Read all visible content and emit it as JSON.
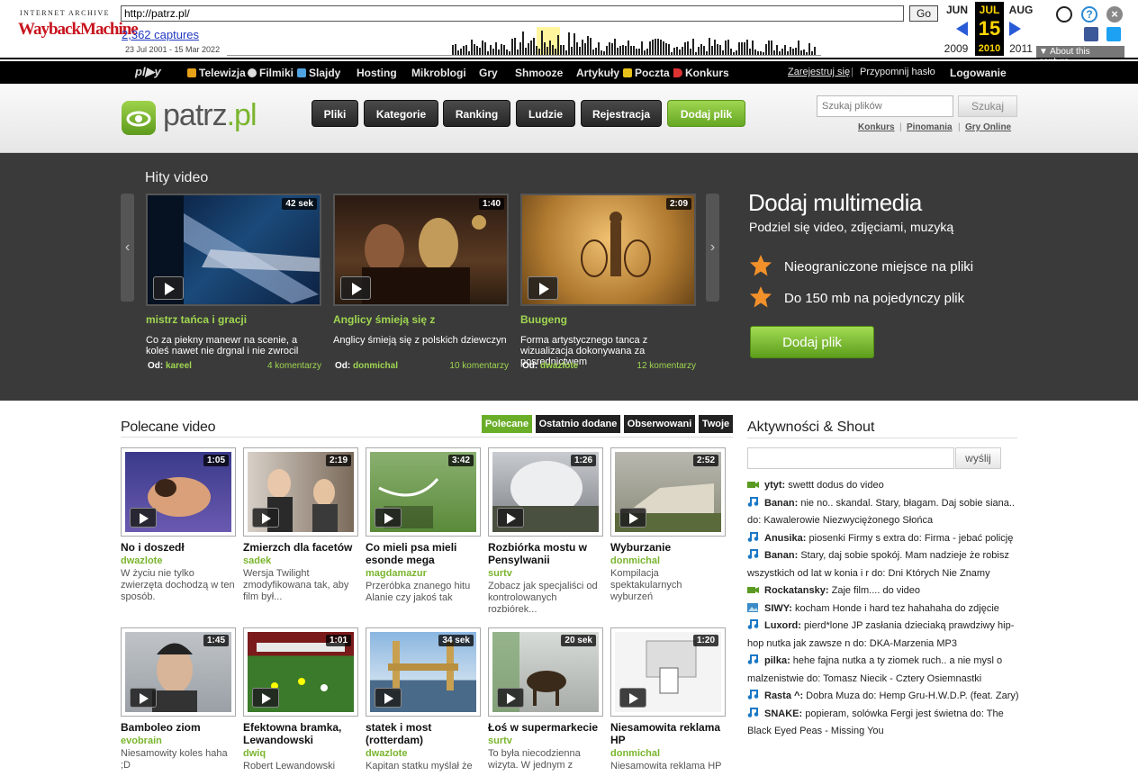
{
  "wayback": {
    "logo_top": "INTERNET ARCHIVE",
    "logo_main": "WaybackMachine",
    "url": "http://patrz.pl/",
    "go": "Go",
    "captures": "2,362 captures",
    "range": "23 Jul 2001 - 15 Mar 2022",
    "prev_month": "JUN",
    "cur_month": "JUL",
    "next_month": "AUG",
    "prev_year": "2009",
    "cur_day": "15",
    "cur_year": "2010",
    "next_year": "2011",
    "about": "▼ About this capture"
  },
  "topnav": {
    "items": [
      "Telewizja",
      "Filmiki",
      "Slajdy",
      "Hosting",
      "Mikroblogi",
      "Gry",
      "Shmooze",
      "Artykuły",
      "Poczta",
      "Konkurs"
    ],
    "register": "Zarejestruj się",
    "sep": "|",
    "remind": "Przypomnij hasło",
    "login": "Logowanie"
  },
  "header": {
    "logo_a": "patrz",
    "logo_b": ".pl",
    "nav": [
      "Pliki",
      "Kategorie",
      "Ranking",
      "Ludzie",
      "Rejestracja",
      "Dodaj plik"
    ],
    "search_placeholder": "Szukaj plików",
    "search_btn": "Szukaj",
    "links": [
      "Konkurs",
      "Pinomania",
      "Gry Online"
    ]
  },
  "hits": {
    "title": "Hity video",
    "prev": "‹",
    "next": "›",
    "items": [
      {
        "dur": "42 sek",
        "title": "mistrz tańca i gracji",
        "desc": "Co za piekny manewr na scenie, a koleś nawet nie drgnal i nie zwrocil",
        "by_label": "Od:",
        "author": "kareel",
        "comments": "4 komentarzy"
      },
      {
        "dur": "1:40",
        "title": "Anglicy śmieją się z",
        "desc": "Anglicy śmieją się z polskich dziewczyn",
        "by_label": "Od:",
        "author": "donmichal",
        "comments": "10 komentarzy"
      },
      {
        "dur": "2:09",
        "title": "Buugeng",
        "desc": "Forma artystycznego tanca z wizualizacja dokonywana za posrednictwem",
        "by_label": "Od:",
        "author": "dwazlote",
        "comments": "12 komentarzy"
      }
    ],
    "promo": {
      "title": "Dodaj multimedia",
      "subtitle": "Podziel się video, zdjęciami, muzyką",
      "f1": "Nieograniczone miejsce na pliki",
      "f2": "Do 150 mb na pojedynczy plik",
      "button": "Dodaj plik"
    }
  },
  "polecane": {
    "title": "Polecane video",
    "tabs": [
      "Polecane",
      "Ostatnio dodane",
      "Obserwowani",
      "Twoje"
    ],
    "row1": [
      {
        "dur": "1:05",
        "title": "No i doszedł",
        "author": "dwazlote",
        "desc": "W życiu nie tylko zwierzęta dochodzą w ten sposób."
      },
      {
        "dur": "2:19",
        "title": "Zmierzch dla facetów",
        "author": "sadek",
        "desc": "Wersja Twilight zmodyfikowana tak, aby film był..."
      },
      {
        "dur": "3:42",
        "title": "Co mieli psa mieli esonde mega",
        "author": "magdamazur",
        "desc": "Przeróbka znanego hitu Alanie czy jakoś tak"
      },
      {
        "dur": "1:26",
        "title": "Rozbiórka mostu w Pensylwanii",
        "author": "surtv",
        "desc": "Zobacz jak specjaliści od kontrolowanych rozbiórek..."
      },
      {
        "dur": "2:52",
        "title": "Wyburzanie",
        "author": "donmichal",
        "desc": "Kompilacja spektakularnych wyburzeń"
      }
    ],
    "row2": [
      {
        "dur": "1:45",
        "title": "Bamboleo ziom",
        "author": "evobrain",
        "desc": "Niesamowity koles haha ;D"
      },
      {
        "dur": "1:01",
        "title": "Efektowna bramka, Lewandowski",
        "author": "dwiq",
        "desc": "Robert Lewandowski"
      },
      {
        "dur": "34 sek",
        "title": "statek i most (rotterdam)",
        "author": "dwazlote",
        "desc": "Kapitan statku myślał że"
      },
      {
        "dur": "20 sek",
        "title": "Łoś w supermarkecie",
        "author": "surtv",
        "desc": "To była niecodzienna wizyta. W jednym z"
      },
      {
        "dur": "1:20",
        "title": "Niesamowita reklama HP",
        "author": "donmichal",
        "desc": "Niesamowita reklama HP"
      }
    ]
  },
  "aktywnosci": {
    "title": "Aktywności & Shout",
    "send": "wyślij",
    "items": [
      {
        "type": "video",
        "user": "ytyt:",
        "text": " swettt dodus do video"
      },
      {
        "type": "music",
        "user": "Banan:",
        "text": " nie no.. skandal. Stary, błagam. Daj sobie siana.. do: Kawalerowie Niezwyciężonego Słońca"
      },
      {
        "type": "music",
        "user": "Anusika:",
        "text": " piosenki Firmy s extra do: Firma - jebać policję"
      },
      {
        "type": "music",
        "user": "Banan:",
        "text": " Stary, daj sobie spokój. Mam nadzieje że robisz wszystkich od lat w konia i r do: Dni Których Nie Znamy"
      },
      {
        "type": "video",
        "user": "Rockatansky:",
        "text": " Zaje film.... do video"
      },
      {
        "type": "image",
        "user": "SIWY:",
        "text": " kocham Honde i hard tez hahahaha do zdjęcie"
      },
      {
        "type": "music",
        "user": "Luxord:",
        "text": " pierd*lone JP zasłania dzieciaką prawdziwy hip-hop nutka jak zawsze n do: DKA-Marzenia MP3"
      },
      {
        "type": "music",
        "user": "pilka:",
        "text": " hehe fajna nutka a ty ziomek ruch.. a nie mysl o malzenistwie do: Tomasz Niecik - Cztery Osiemnastki"
      },
      {
        "type": "music",
        "user": "Rasta ^:",
        "text": " Dobra Muza do: Hemp Gru-H.W.D.P. (feat. Zary)"
      },
      {
        "type": "music",
        "user": "SNAKE:",
        "text": " popieram, solówka Fergi jest świetna do: The Black Eyed Peas - Missing You"
      }
    ]
  },
  "colors": {
    "green": "#7ab52e",
    "dark": "#3a3a3a",
    "wayback_red": "#c8141e"
  }
}
